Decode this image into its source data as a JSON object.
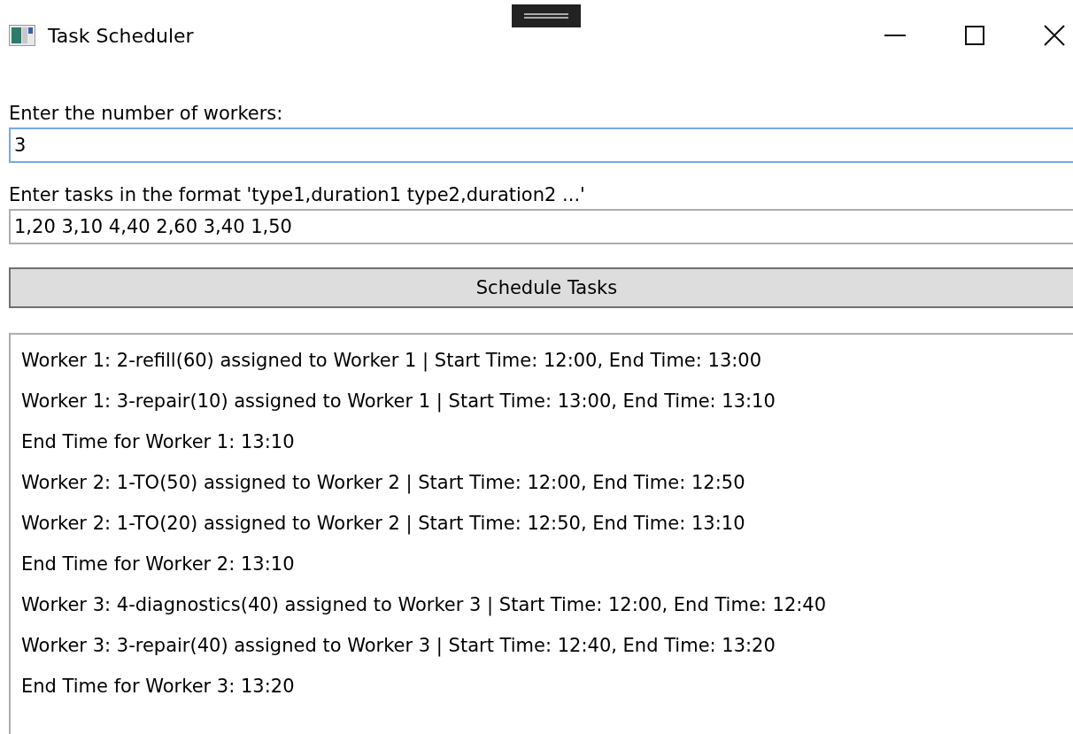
{
  "window": {
    "title": "Task Scheduler"
  },
  "workers_field": {
    "label": "Enter the number of workers:",
    "value": "3",
    "focused": true
  },
  "tasks_field": {
    "label": "Enter tasks in the format 'type1,duration1 type2,duration2 ...'",
    "value": "1,20 3,10 4,40 2,60 3,40 1,50",
    "focused": false
  },
  "schedule_button": {
    "label": "Schedule Tasks"
  },
  "output_lines": [
    "Worker 1: 2-refill(60) assigned to Worker 1 | Start Time: 12:00, End Time: 13:00",
    "Worker 1: 3-repair(10) assigned to Worker 1 | Start Time: 13:00, End Time: 13:10",
    "End Time for Worker 1: 13:10",
    "Worker 2: 1-TO(50) assigned to Worker 2 | Start Time: 12:00, End Time: 12:50",
    "Worker 2: 1-TO(20) assigned to Worker 2 | Start Time: 12:50, End Time: 13:10",
    "End Time for Worker 2: 13:10",
    "Worker 3: 4-diagnostics(40) assigned to Worker 3 | Start Time: 12:00, End Time: 12:40",
    "Worker 3: 3-repair(40) assigned to Worker 3 | Start Time: 12:40, End Time: 13:20",
    "End Time for Worker 3: 13:20"
  ]
}
